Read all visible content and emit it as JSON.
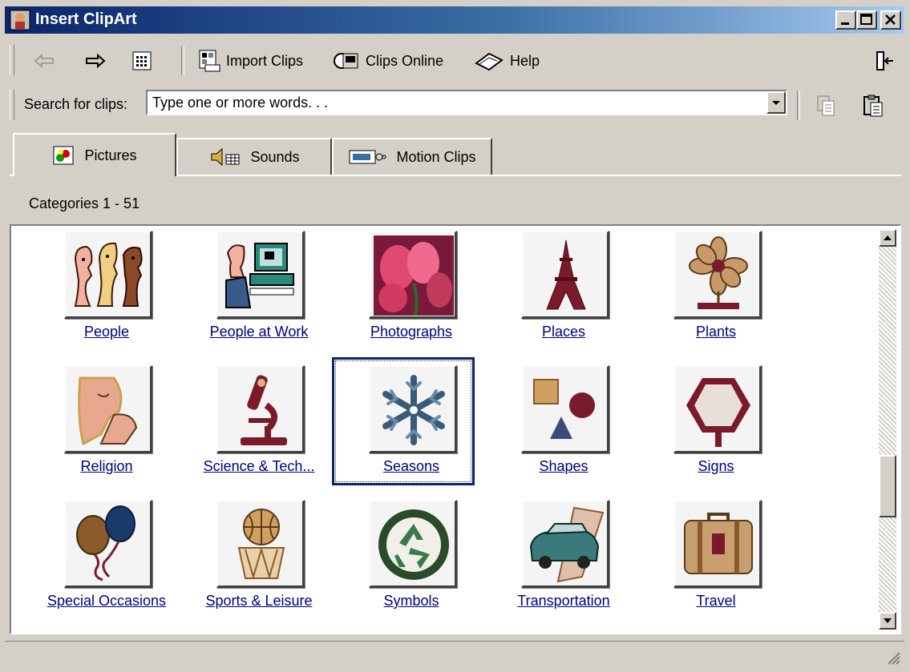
{
  "window": {
    "title": "Insert ClipArt"
  },
  "toolbar": {
    "back_label": "",
    "forward_label": "",
    "view_label": "",
    "import_clips": "Import Clips",
    "clips_online": "Clips Online",
    "help": "Help"
  },
  "search": {
    "label": "Search for clips:",
    "value": "Type one or more words. . ."
  },
  "tabs": [
    {
      "label": "Pictures",
      "icon": "pictures-icon",
      "active": true
    },
    {
      "label": "Sounds",
      "icon": "sounds-icon",
      "active": false
    },
    {
      "label": "Motion Clips",
      "icon": "motion-clips-icon",
      "active": false
    }
  ],
  "categories": {
    "range_label": "Categories 1 - 51",
    "items": [
      {
        "label": "People",
        "icon": "people-icon"
      },
      {
        "label": "People at Work",
        "icon": "people-at-work-icon"
      },
      {
        "label": "Photographs",
        "icon": "photographs-icon"
      },
      {
        "label": "Places",
        "icon": "eiffel-tower-icon"
      },
      {
        "label": "Plants",
        "icon": "flower-icon"
      },
      {
        "label": "Religion",
        "icon": "religion-icon"
      },
      {
        "label": "Science & Tech...",
        "icon": "microscope-icon"
      },
      {
        "label": "Seasons",
        "icon": "snowflake-icon",
        "selected": true
      },
      {
        "label": "Shapes",
        "icon": "shapes-icon"
      },
      {
        "label": "Signs",
        "icon": "sign-icon"
      },
      {
        "label": "Special Occasions",
        "icon": "balloons-icon"
      },
      {
        "label": "Sports & Leisure",
        "icon": "basketball-icon"
      },
      {
        "label": "Symbols",
        "icon": "recycle-icon"
      },
      {
        "label": "Transportation",
        "icon": "car-icon"
      },
      {
        "label": "Travel",
        "icon": "suitcase-icon"
      }
    ]
  },
  "colors": {
    "title_gradient_start": "#0a246a",
    "link": "#00007b",
    "face": "#d4d0c8"
  }
}
